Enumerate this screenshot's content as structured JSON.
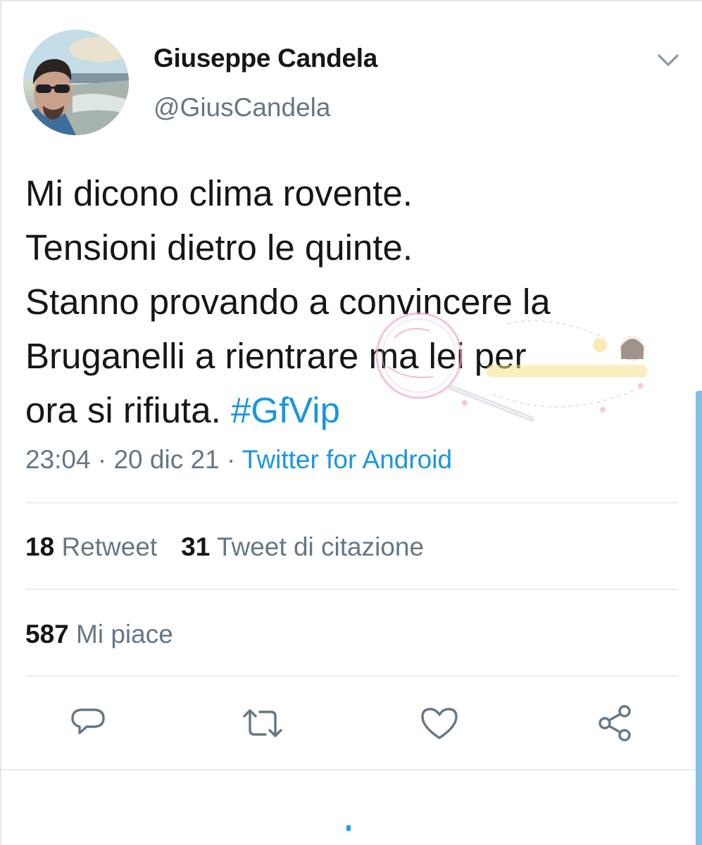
{
  "tweet": {
    "author_name": "Giuseppe Candela",
    "author_handle": "@GiusCandela",
    "text_lines": [
      "Mi dicono clima rovente.",
      "Tensioni dietro le quinte.",
      "Stanno provando a convincere la",
      "Bruganelli a rientrare ma lei per",
      "ora si rifiuta. "
    ],
    "hashtag": "#GfVip",
    "time": "23:04",
    "date": "20 dic 21",
    "separator": " · ",
    "source": "Twitter for Android"
  },
  "stats": {
    "retweets_count": "18",
    "retweets_label": "Retweet",
    "quotes_count": "31",
    "quotes_label": "Tweet di citazione",
    "likes_count": "587",
    "likes_label": "Mi piace"
  },
  "actions": [
    {
      "name": "reply",
      "icon": "reply-icon"
    },
    {
      "name": "retweet",
      "icon": "retweet-icon"
    },
    {
      "name": "like",
      "icon": "heart-icon"
    },
    {
      "name": "share",
      "icon": "share-icon"
    }
  ],
  "colors": {
    "link": "#1b95e0",
    "secondary_text": "#657786",
    "icon": "#657786",
    "divider": "#e6ecf0"
  }
}
